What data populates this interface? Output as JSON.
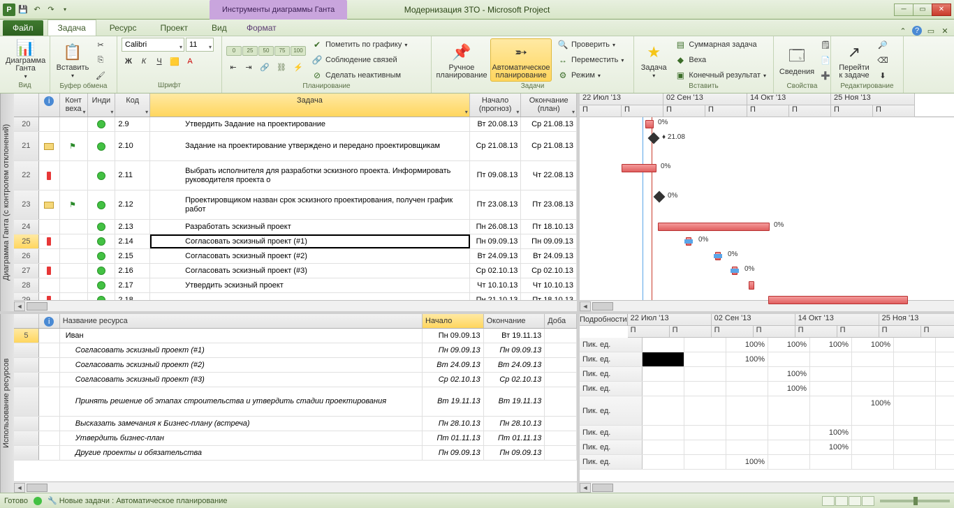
{
  "title": "Модернизация 3ТО  -  Microsoft Project",
  "contextual_tab": "Инструменты диаграммы Ганта",
  "tabs": {
    "file": "Файл",
    "task": "Задача",
    "resource": "Ресурс",
    "project": "Проект",
    "view": "Вид",
    "format": "Формат"
  },
  "ribbon": {
    "groups": {
      "view": "Вид",
      "clipboard": "Буфер обмена",
      "font": "Шрифт",
      "planning": "Планирование",
      "tasks": "Задачи",
      "insert": "Вставить",
      "properties": "Свойства",
      "editing": "Редактирование"
    },
    "gantt": "Диаграмма Ганта",
    "paste": "Вставить",
    "font_name": "Calibri",
    "font_size": "11",
    "mark": "Пометить по графику",
    "links": "Соблюдение связей",
    "inactive": "Сделать неактивным",
    "manual": "Ручное планирование",
    "auto": "Автоматическое планирование",
    "check": "Проверить",
    "move": "Переместить",
    "mode": "Режим",
    "task_btn": "Задача",
    "summary": "Суммарная задача",
    "milestone": "Веха",
    "deliverable": "Конечный результат",
    "info": "Сведения",
    "goto": "Перейти к задаче"
  },
  "columns": {
    "milestone": "Конт веха",
    "indicator": "Инди",
    "code": "Код",
    "task": "Задача",
    "start": "Начало (прогноз)",
    "finish": "Окончание (план)"
  },
  "rows": [
    {
      "n": "20",
      "code": "2.9",
      "name": "Утвердить Задание на проектирование",
      "start": "Вт 20.08.13",
      "finish": "Ср 21.08.13",
      "ind": "g"
    },
    {
      "n": "21",
      "code": "2.10",
      "name": "Задание на проектирование утверждено и передано проектировщикам",
      "start": "Ср 21.08.13",
      "finish": "Ср 21.08.13",
      "ind": "g",
      "note": true,
      "mile": true,
      "dbl": true
    },
    {
      "n": "22",
      "code": "2.11",
      "name": "Выбрать исполнителя для разработки эскизного проекта. Информировать руководителя проекта о",
      "start": "Пт 09.08.13",
      "finish": "Чт 22.08.13",
      "ind": "g",
      "red": true,
      "dbl": true
    },
    {
      "n": "23",
      "code": "2.12",
      "name": "Проектировщиком назван срок эскизного проектирования, получен график работ",
      "start": "Пт 23.08.13",
      "finish": "Пт 23.08.13",
      "ind": "g",
      "note": true,
      "mile": true,
      "dbl": true
    },
    {
      "n": "24",
      "code": "2.13",
      "name": "Разработать эскизный проект",
      "start": "Пн 26.08.13",
      "finish": "Пт 18.10.13",
      "ind": "g"
    },
    {
      "n": "25",
      "code": "2.14",
      "name": "Согласовать эскизный проект (#1)",
      "start": "Пн 09.09.13",
      "finish": "Пн 09.09.13",
      "ind": "g",
      "red": true,
      "sel": true
    },
    {
      "n": "26",
      "code": "2.15",
      "name": "Согласовать эскизный проект (#2)",
      "start": "Вт 24.09.13",
      "finish": "Вт 24.09.13",
      "ind": "g"
    },
    {
      "n": "27",
      "code": "2.16",
      "name": "Согласовать эскизный проект (#3)",
      "start": "Ср 02.10.13",
      "finish": "Ср 02.10.13",
      "ind": "g",
      "red": true
    },
    {
      "n": "28",
      "code": "2.17",
      "name": "Утвердить эскизный проект",
      "start": "Чт 10.10.13",
      "finish": "Чт 10.10.13",
      "ind": "g"
    },
    {
      "n": "29",
      "code": "2.18",
      "name": "",
      "start": "Пн 21.10.13",
      "finish": "Пт 18.10.13",
      "ind": "g",
      "red": true
    }
  ],
  "timeline": {
    "dates": [
      "22 Июл '13",
      "02 Сен '13",
      "14 Окт '13",
      "25 Ноя '13"
    ],
    "sub": "П"
  },
  "gantt_pcts": [
    "0%",
    "0%",
    "0%",
    "0%",
    "0%",
    "0%",
    "0%"
  ],
  "gantt_milestone_label": "21.08",
  "res_columns": {
    "info": "",
    "name": "Название ресурса",
    "start": "Начало",
    "finish": "Окончание",
    "extra": "Доба"
  },
  "res_id": "5",
  "res_rows": [
    {
      "name": "Иван",
      "start": "Пн 09.09.13",
      "finish": "Вт 19.11.13",
      "sub": false
    },
    {
      "name": "Согласовать эскизный проект (#1)",
      "start": "Пн 09.09.13",
      "finish": "Пн 09.09.13",
      "sub": true
    },
    {
      "name": "Согласовать эскизный проект (#2)",
      "start": "Вт 24.09.13",
      "finish": "Вт 24.09.13",
      "sub": true
    },
    {
      "name": "Согласовать эскизный проект (#3)",
      "start": "Ср 02.10.13",
      "finish": "Ср 02.10.13",
      "sub": true
    },
    {
      "name": "Принять решение об этапах строительства  и утвердить стадии проектирования",
      "start": "Вт 19.11.13",
      "finish": "Вт 19.11.13",
      "sub": true,
      "dbl": true
    },
    {
      "name": "Высказать замечания к Бизнес-плану (встреча)",
      "start": "Пн 28.10.13",
      "finish": "Пн 28.10.13",
      "sub": true
    },
    {
      "name": "Утвердить бизнес-план",
      "start": "Пт 01.11.13",
      "finish": "Пт 01.11.13",
      "sub": true
    },
    {
      "name": "Другие проекты и обязательства",
      "start": "Пн 09.09.13",
      "finish": "Пн 09.09.13",
      "sub": true
    }
  ],
  "details_label": "Подробности",
  "details_row_label": "Пик. ед.",
  "details": [
    [
      null,
      null,
      "100%",
      "100%",
      "100%",
      "100%",
      null
    ],
    [
      "BLACK",
      null,
      "100%",
      null,
      null,
      null,
      null
    ],
    [
      null,
      null,
      null,
      "100%",
      null,
      null,
      null
    ],
    [
      null,
      null,
      null,
      "100%",
      null,
      null,
      null
    ],
    [
      null,
      null,
      null,
      null,
      null,
      "100%",
      null
    ],
    [
      null,
      null,
      null,
      null,
      "100%",
      null,
      null
    ],
    [
      null,
      null,
      null,
      null,
      "100%",
      null,
      null
    ],
    [
      null,
      null,
      "100%",
      null,
      null,
      null,
      null
    ]
  ],
  "status": {
    "ready": "Готово",
    "new_tasks": "Новые задачи : Автоматическое планирование"
  },
  "vbar_top": "Диаграмма Ганта (с контролем отклонений)",
  "vbar_bottom": "Использование ресурсов"
}
